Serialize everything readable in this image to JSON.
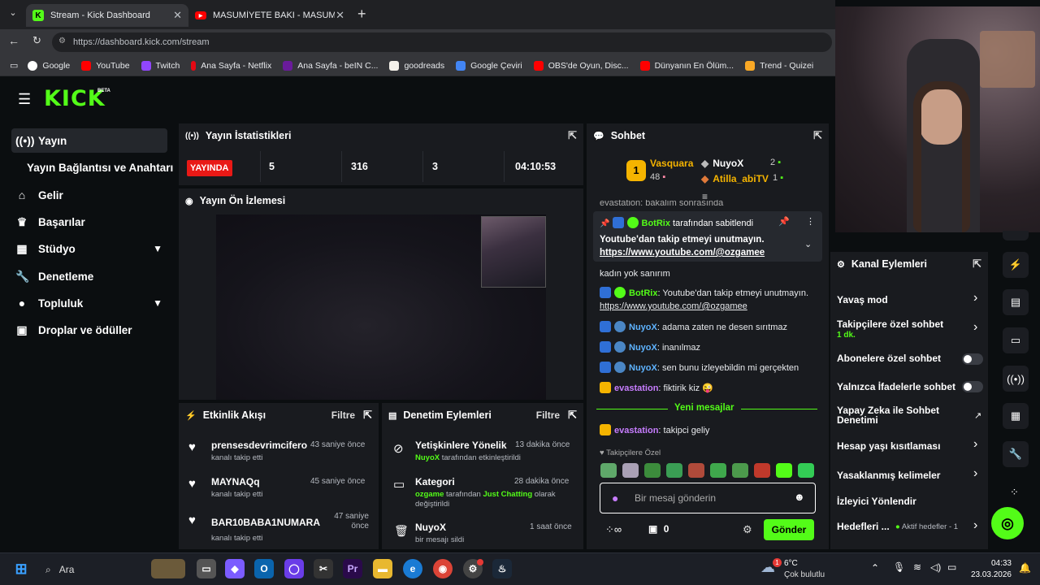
{
  "browser": {
    "tabs": [
      {
        "title": "Stream - Kick Dashboard"
      },
      {
        "title": "MASUMİYETE BAKI - MASUMİYET"
      }
    ],
    "url": "https://dashboard.kick.com/stream",
    "bookmarks": [
      "Google",
      "YouTube",
      "Twitch",
      "Ana Sayfa - Netflix",
      "Ana Sayfa - beIN C...",
      "goodreads",
      "Google Çeviri",
      "OBS'de Oyun, Disc...",
      "Dünyanın En Ölüm...",
      "Trend - Quizei"
    ]
  },
  "brand": {
    "logo": "KICK",
    "beta": "BETA",
    "accent": "#53fc18"
  },
  "sidebar": {
    "items": [
      {
        "label": "Yayın",
        "icon": "broadcast-icon"
      },
      {
        "label": "Yayın Bağlantısı ve Anahtarı",
        "icon": ""
      },
      {
        "label": "Gelir",
        "icon": "bank-icon"
      },
      {
        "label": "Başarılar",
        "icon": "trophy-icon"
      },
      {
        "label": "Stüdyo",
        "icon": "layout-icon"
      },
      {
        "label": "Denetleme",
        "icon": "wrench-icon"
      },
      {
        "label": "Topluluk",
        "icon": "user-icon"
      },
      {
        "label": "Droplar ve ödüller",
        "icon": "gift-icon"
      }
    ]
  },
  "stats": {
    "title": "Yayın İstatistikleri",
    "live": "YAYINDA",
    "values": [
      "5",
      "316",
      "3",
      "04:10:53"
    ]
  },
  "preview": {
    "title": "Yayın Ön İzlemesi"
  },
  "activity": {
    "title": "Etkinlik Akışı",
    "filter": "Filtre",
    "items": [
      {
        "user": "prensesdevrimcifero",
        "action": "kanalı takip etti",
        "time": "43 saniye önce"
      },
      {
        "user": "MAYNAQq",
        "action": "kanalı takip etti",
        "time": "45 saniye önce"
      },
      {
        "user": "BAR10BABA1NUMARA",
        "action": "kanalı takip etti",
        "time": "47 saniye önce"
      }
    ]
  },
  "moderation": {
    "title": "Denetim Eylemleri",
    "filter": "Filtre",
    "items": [
      {
        "title": "Yetişkinlere Yönelik",
        "actor": "NuyoX",
        "desc": "tarafından etkinleştirildi",
        "time": "13 dakika önce"
      },
      {
        "title": "Kategori",
        "actor": "ozgame",
        "desc": "tarafından",
        "highlight": "Just Chatting",
        "desc2": "olarak değiştirildi",
        "time": "28 dakika önce"
      },
      {
        "title": "NuyoX",
        "desc": "bir mesajı sildi",
        "time": "1 saat önce"
      }
    ]
  },
  "chat": {
    "title": "Sohbet",
    "leaderboard": {
      "first": {
        "rank": "1",
        "name": "Vasquara",
        "count": "48"
      },
      "second": {
        "name": "NuyoX",
        "count": "2"
      },
      "third": {
        "name": "Atilla_abiTV",
        "count": "1"
      }
    },
    "cut_msg": "evastation: bakalım sonrasında",
    "pinned": {
      "user": "BotRix",
      "header_suffix": "tarafından sabitlendi",
      "text": "Youtube'dan takip etmeyi unutmayın.",
      "link": "https://www.youtube.com/@ozgamee"
    },
    "messages": [
      {
        "user": "",
        "text": "kadın yok sanırım"
      },
      {
        "user": "BotRix",
        "text": "Youtube'dan takip etmeyi unutmayın.",
        "link": "https://www.youtube.com/@ozgamee"
      },
      {
        "user": "NuyoX",
        "text": "adama zaten ne desen sırıtmaz"
      },
      {
        "user": "NuyoX",
        "text": "inanılmaz"
      },
      {
        "user": "NuyoX",
        "text": "sen bunu izleyebildin mi gerçekten"
      },
      {
        "user": "evastation",
        "text": "fiktirik kiz 😜"
      }
    ],
    "new_messages": "Yeni mesajlar",
    "after": {
      "user": "evastation",
      "text": "takipci geliy"
    },
    "followers_only": "Takipçilere Özel",
    "placeholder": "Bir mesaj gönderin",
    "count": "0",
    "send": "Gönder"
  },
  "actions": {
    "title": "Kanal Eylemleri",
    "items": [
      {
        "label": "Yavaş mod",
        "control": "chevron"
      },
      {
        "label": "Takipçilere özel sohbet",
        "sub": "1 dk.",
        "control": "chevron"
      },
      {
        "label": "Abonelere özel sohbet",
        "control": "toggle"
      },
      {
        "label": "Yalnızca İfadelerle sohbet",
        "control": "toggle"
      },
      {
        "label": "Yapay Zeka ile Sohbet Denetimi",
        "control": "external"
      },
      {
        "label": "Hesap yaşı kısıtlaması",
        "control": "chevron"
      },
      {
        "label": "Yasaklanmış kelimeler",
        "control": "chevron"
      },
      {
        "label": "İzleyici Yönlendir",
        "control": "none"
      },
      {
        "label": "Hedefleri ...",
        "sub": "Aktif hedefler - 1",
        "control": "chevron"
      }
    ]
  },
  "taskbar": {
    "search": "Ara",
    "weather_temp": "6°C",
    "weather_desc": "Çok bulutlu",
    "time": "04:33",
    "date": "23.03.2026",
    "badge": "1"
  }
}
